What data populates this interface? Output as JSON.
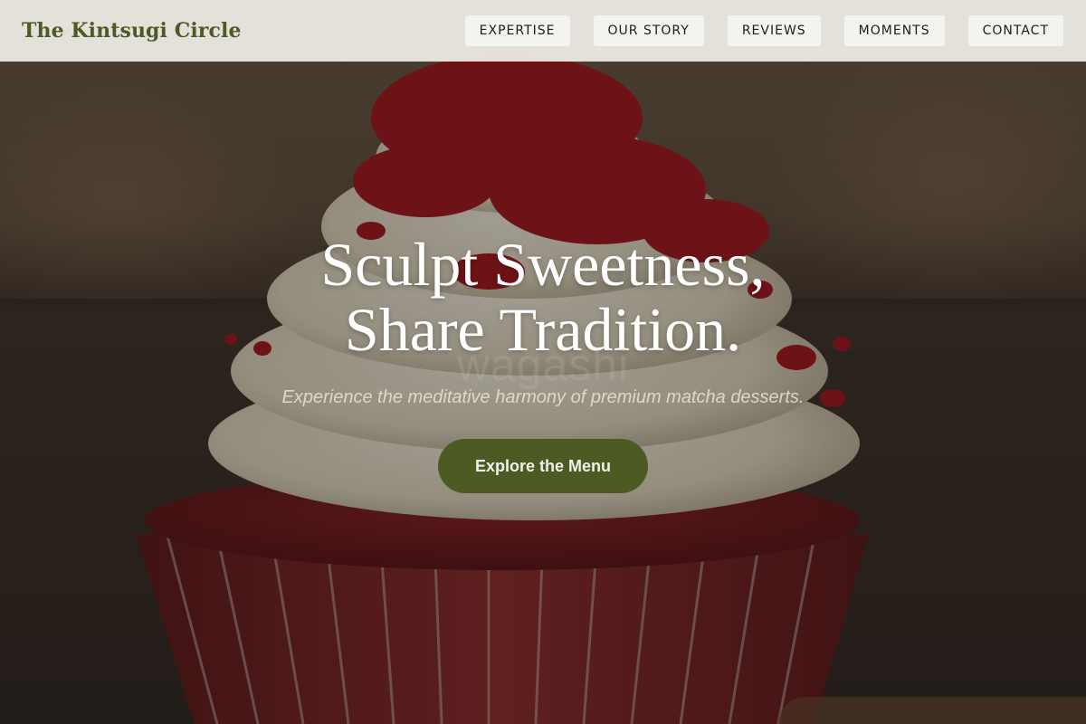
{
  "brand": {
    "name": "The Kintsugi Circle"
  },
  "nav": {
    "items": [
      {
        "label": "EXPERTISE"
      },
      {
        "label": "OUR STORY"
      },
      {
        "label": "REVIEWS"
      },
      {
        "label": "MOMENTS"
      },
      {
        "label": "CONTACT"
      }
    ]
  },
  "hero": {
    "headline_line1": "Sculpt Sweetness,",
    "headline_line2": "Share Tradition.",
    "watermark": "wagashi",
    "subtitle": "Experience the meditative harmony of premium matcha desserts.",
    "cta_label": "Explore the Menu",
    "image_subject": "red-velvet-cupcake-image"
  },
  "colors": {
    "brand": "#4e5a26",
    "cta_background": "#4c5a24",
    "header_background": "#f0eee8"
  }
}
